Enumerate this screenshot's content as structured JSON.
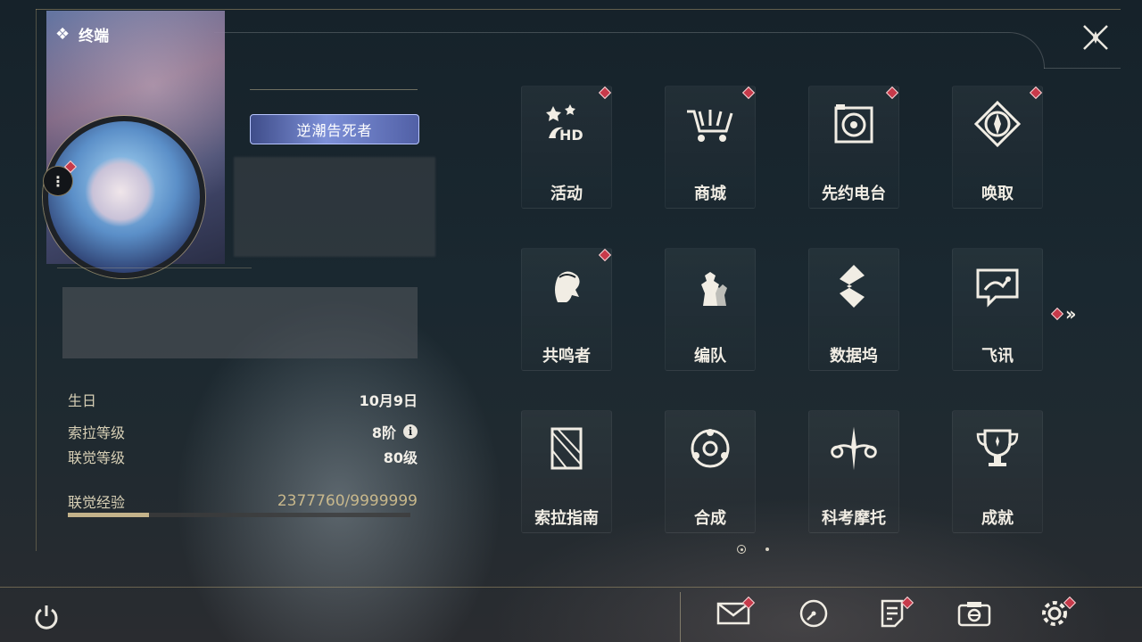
{
  "header": {
    "title": "终端"
  },
  "profile": {
    "badge_label": "逆潮告死者"
  },
  "stats": {
    "birthday_label": "生日",
    "birthday_value": "10月9日",
    "sola_level_label": "索拉等级",
    "sola_level_value": "8阶",
    "union_level_label": "联觉等级",
    "union_level_value": "80级",
    "exp_label": "联觉经验",
    "exp_value": "2377760/9999999",
    "exp_progress": 0.2378
  },
  "menu": {
    "items": [
      {
        "label": "活动",
        "icon": "event-icon",
        "badge": true
      },
      {
        "label": "商城",
        "icon": "shop-icon",
        "badge": true
      },
      {
        "label": "先约电台",
        "icon": "radio-icon",
        "badge": true
      },
      {
        "label": "唤取",
        "icon": "convene-icon",
        "badge": true
      },
      {
        "label": "共鸣者",
        "icon": "resonator-icon",
        "badge": true
      },
      {
        "label": "编队",
        "icon": "team-icon",
        "badge": false
      },
      {
        "label": "数据坞",
        "icon": "databank-icon",
        "badge": false
      },
      {
        "label": "飞讯",
        "icon": "message-icon",
        "badge": false
      },
      {
        "label": "索拉指南",
        "icon": "guidebook-icon",
        "badge": false
      },
      {
        "label": "合成",
        "icon": "synthesis-icon",
        "badge": false
      },
      {
        "label": "科考摩托",
        "icon": "motorcycle-icon",
        "badge": false
      },
      {
        "label": "成就",
        "icon": "achievement-icon",
        "badge": false
      }
    ],
    "page_count": 2,
    "current_page": 1
  },
  "bottom_bar": [
    {
      "icon": "mail-icon",
      "badge": true
    },
    {
      "icon": "clock-icon",
      "badge": false
    },
    {
      "icon": "notice-icon",
      "badge": true
    },
    {
      "icon": "camera-icon",
      "badge": false
    },
    {
      "icon": "settings-icon",
      "badge": true
    }
  ],
  "colors": {
    "accent_gold": "#c4b38a",
    "badge_red": "#c73a4a",
    "text": "#f1ede4"
  }
}
